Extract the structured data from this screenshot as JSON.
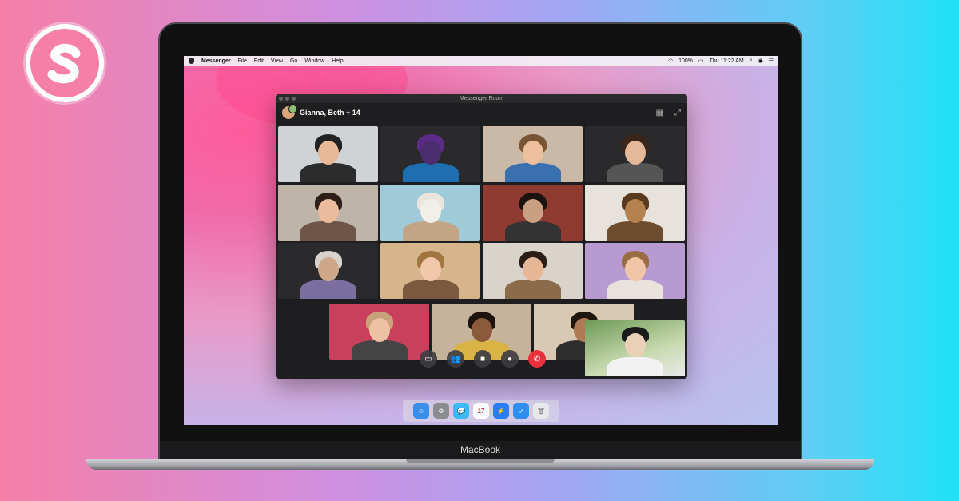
{
  "brand": {
    "logo_letter": "S",
    "logo_color": "#f57fa7"
  },
  "menubar": {
    "app_name": "Messenger",
    "items": [
      "File",
      "Edit",
      "View",
      "Go",
      "Window",
      "Help"
    ],
    "battery": "100%",
    "clock": "Thu 11:22 AM"
  },
  "window": {
    "title": "Messenger Room",
    "room_name": "Gianna, Beth + 14",
    "icons": [
      "grid-view-icon",
      "expand-icon"
    ]
  },
  "participants": {
    "rows": [
      [
        {
          "bg": "#cfd3d6",
          "skin": "#e9b896",
          "hair": "#222",
          "shirt": "#2c2c2c"
        },
        {
          "bg": "#2a2a2d",
          "skin": "#4b2c6e",
          "hair": "#5b2c86",
          "shirt": "#1f6fb0"
        },
        {
          "bg": "#c9b9a6",
          "skin": "#eebf9c",
          "hair": "#7a5535",
          "shirt": "#3a6fb0"
        },
        {
          "bg": "#2a2a2d",
          "skin": "#e4b899",
          "hair": "#3b2418",
          "shirt": "#555"
        }
      ],
      [
        {
          "bg": "#bfb4a8",
          "skin": "#eabb9c",
          "hair": "#2d1f17",
          "shirt": "#6d5548"
        },
        {
          "bg": "#9fcad8",
          "skin": "#f2efe8",
          "hair": "#e9e5dc",
          "shirt": "#c2a584"
        },
        {
          "bg": "#8f3b32",
          "skin": "#caa082",
          "hair": "#1c130f",
          "shirt": "#333"
        },
        {
          "bg": "#e7e2dc",
          "skin": "#b5814e",
          "hair": "#5a3a1e",
          "shirt": "#6c4b2e"
        }
      ],
      [
        {
          "bg": "#2a2a2d",
          "skin": "#cfa789",
          "hair": "#d8d2cc",
          "shirt": "#7b6ea0"
        },
        {
          "bg": "#d6b58d",
          "skin": "#f1c9aa",
          "hair": "#a17541",
          "shirt": "#7a5a3e"
        },
        {
          "bg": "#d8d4cc",
          "skin": "#e6b797",
          "hair": "#2b1d15",
          "shirt": "#8a6b4a"
        },
        {
          "bg": "#b69ad0",
          "skin": "#f0c6a6",
          "hair": "#9a6d45",
          "shirt": "#e9e2dc"
        }
      ],
      [
        {
          "bg": "#c9405c",
          "skin": "#eec0a4",
          "hair": "#c8a27a",
          "shirt": "#444"
        },
        {
          "bg": "#c5b49b",
          "skin": "#8a5a3a",
          "hair": "#1e140e",
          "shirt": "#d9b346"
        },
        {
          "bg": "#d9c9b3",
          "skin": "#b07a55",
          "hair": "#1f1610",
          "shirt": "#2d2d2d"
        }
      ]
    ],
    "self": {
      "skin": "#ead0b6",
      "hair": "#1a1a1a",
      "shirt": "#f2f2f2"
    }
  },
  "controls": [
    {
      "name": "share-screen-icon",
      "glyph": "▭"
    },
    {
      "name": "participants-icon",
      "glyph": "👥"
    },
    {
      "name": "camera-icon",
      "glyph": "■"
    },
    {
      "name": "microphone-icon",
      "glyph": "●"
    },
    {
      "name": "end-call-icon",
      "glyph": "✆"
    }
  ],
  "dock": [
    {
      "name": "finder-icon",
      "color": "#3a8ee6",
      "glyph": "☺"
    },
    {
      "name": "system-preferences-icon",
      "color": "#8a8c90",
      "glyph": "⚙"
    },
    {
      "name": "messages-icon",
      "color": "#3cb8f5",
      "glyph": "💬"
    },
    {
      "name": "calendar-icon",
      "color": "#ffffff",
      "glyph": "17"
    },
    {
      "name": "messenger-icon",
      "color": "#2a7ef5",
      "glyph": "⚡"
    },
    {
      "name": "safari-icon",
      "color": "#2f8ef0",
      "glyph": "➶"
    },
    {
      "name": "trash-icon",
      "color": "#e8e8ec",
      "glyph": "🗑"
    }
  ],
  "device": {
    "label": "MacBook"
  }
}
